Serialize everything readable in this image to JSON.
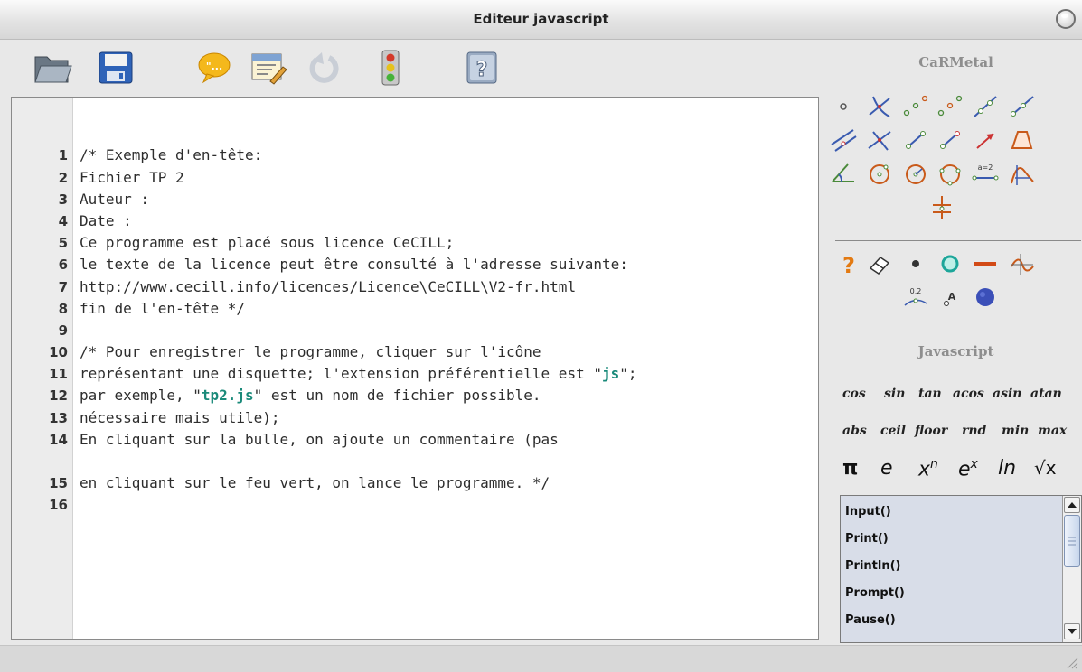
{
  "window": {
    "title": "Editeur javascript"
  },
  "toolbar": {
    "buttons": [
      {
        "name": "open-folder-icon"
      },
      {
        "name": "save-disk-icon"
      },
      {
        "name": "comment-bubble-icon"
      },
      {
        "name": "editor-window-icon"
      },
      {
        "name": "undo-arrow-icon"
      },
      {
        "name": "traffic-light-run-icon"
      },
      {
        "name": "help-icon"
      }
    ]
  },
  "editor": {
    "lines": [
      {
        "n": "1",
        "text": "/* Exemple d'en-tête:"
      },
      {
        "n": "2",
        "text": "Fichier TP 2"
      },
      {
        "n": "3",
        "text": "Auteur :"
      },
      {
        "n": "4",
        "text": "Date :"
      },
      {
        "n": "5",
        "text": "Ce programme est placé sous licence CeCILL;"
      },
      {
        "n": "6",
        "text": "le texte de la licence peut être consulté à l'adresse suivante:"
      },
      {
        "n": "7",
        "text": "http://www.cecill.info/licences/Licence\\CeCILL\\V2-fr.html"
      },
      {
        "n": "8",
        "text": "fin de l'en-tête */"
      },
      {
        "n": "9",
        "text": ""
      },
      {
        "n": "10",
        "text": "/* Pour enregistrer le programme, cliquer sur l'icône"
      },
      {
        "n": "11",
        "text_a": "représentant une disquette; l'extension préférentielle est \"",
        "str": "js",
        "text_b": "\";"
      },
      {
        "n": "12",
        "text_a": "par exemple, \"",
        "str": "tp2.js",
        "text_b": "\" est un nom de fichier possible."
      },
      {
        "n": "13",
        "text": ""
      },
      {
        "n": "14",
        "text": "En cliquant sur la bulle, on ajoute un commentaire (pas",
        "text2": "nécessaire mais utile);"
      },
      {
        "n": "15",
        "text": "en cliquant sur le feu vert, on lance le programme. */"
      },
      {
        "n": "16",
        "text": ""
      }
    ]
  },
  "palette": {
    "geometry_header": "CaRMetal",
    "javascript_header": "Javascript",
    "functions_row1": [
      "cos",
      "sin",
      "tan",
      "acos",
      "asin",
      "atan"
    ],
    "functions_row2": [
      "abs",
      "ceil",
      "floor",
      "rnd",
      "min",
      "max"
    ],
    "symbols": [
      "π",
      "e",
      "x",
      "n",
      "e",
      "x",
      "ln",
      "√x"
    ],
    "segment_label": "a=2",
    "point_label": "0,2",
    "list_items": [
      "Input()",
      "Print()",
      "Println()",
      "Prompt()",
      "Pause()"
    ]
  },
  "colors": {
    "string_literal": "#1a8a7a",
    "header_gray": "#8e8e8e",
    "list_background": "#d8dde8",
    "palette_dot_blue": "#3b4fb8"
  }
}
